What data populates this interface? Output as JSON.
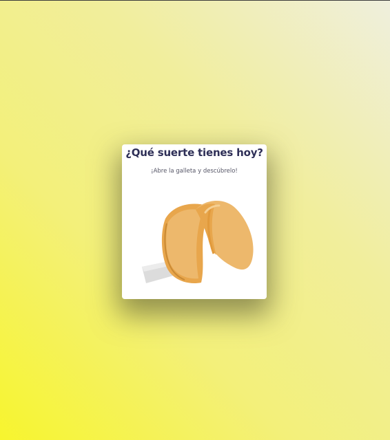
{
  "card": {
    "title": "¿Qué suerte tienes hoy?",
    "subtitle": "¡Abre la galleta y descúbrelo!"
  },
  "cookie": {
    "icon": "fortune-cookie-icon",
    "colors": {
      "light": "#edb86c",
      "mid": "#e8a64c",
      "dark": "#c98a35",
      "paper": "#dcdcdc"
    }
  },
  "background": {
    "colors": [
      "#f7f52e",
      "#f3f07a",
      "#efefdd"
    ]
  }
}
